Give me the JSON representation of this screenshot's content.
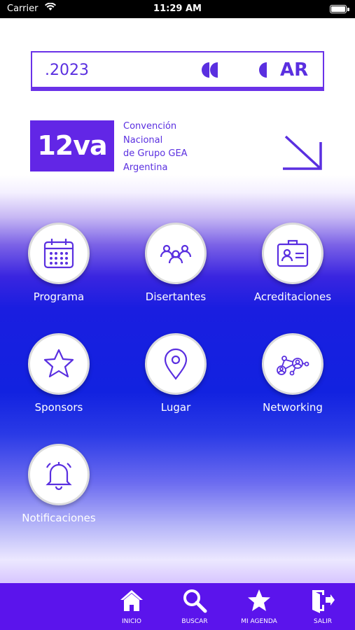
{
  "status_bar": {
    "carrier": "Carrier",
    "time": "11:29 AM"
  },
  "header": {
    "year": ".2023",
    "country": "AR",
    "edition": "12va",
    "edition_lines": [
      "Convención",
      "Nacional",
      "de Grupo GEA",
      "Argentina"
    ]
  },
  "menu": [
    {
      "label": "Programa",
      "icon": "calendar-icon"
    },
    {
      "label": "Disertantes",
      "icon": "people-icon"
    },
    {
      "label": "Acreditaciones",
      "icon": "id-card-icon"
    },
    {
      "label": "Sponsors",
      "icon": "star-icon"
    },
    {
      "label": "Lugar",
      "icon": "location-pin-icon"
    },
    {
      "label": "Networking",
      "icon": "network-icon"
    },
    {
      "label": "Notificaciones",
      "icon": "bell-icon"
    }
  ],
  "tab_bar": [
    {
      "label": "INICIO",
      "icon": "home-icon"
    },
    {
      "label": "BUSCAR",
      "icon": "search-icon"
    },
    {
      "label": "MI AGENDA",
      "icon": "star-icon"
    },
    {
      "label": "SALIR",
      "icon": "exit-door-icon"
    }
  ],
  "colors": {
    "brand_purple": "#6226e6",
    "tab_bar": "#5b14ec",
    "blue": "#1a1ee0"
  }
}
